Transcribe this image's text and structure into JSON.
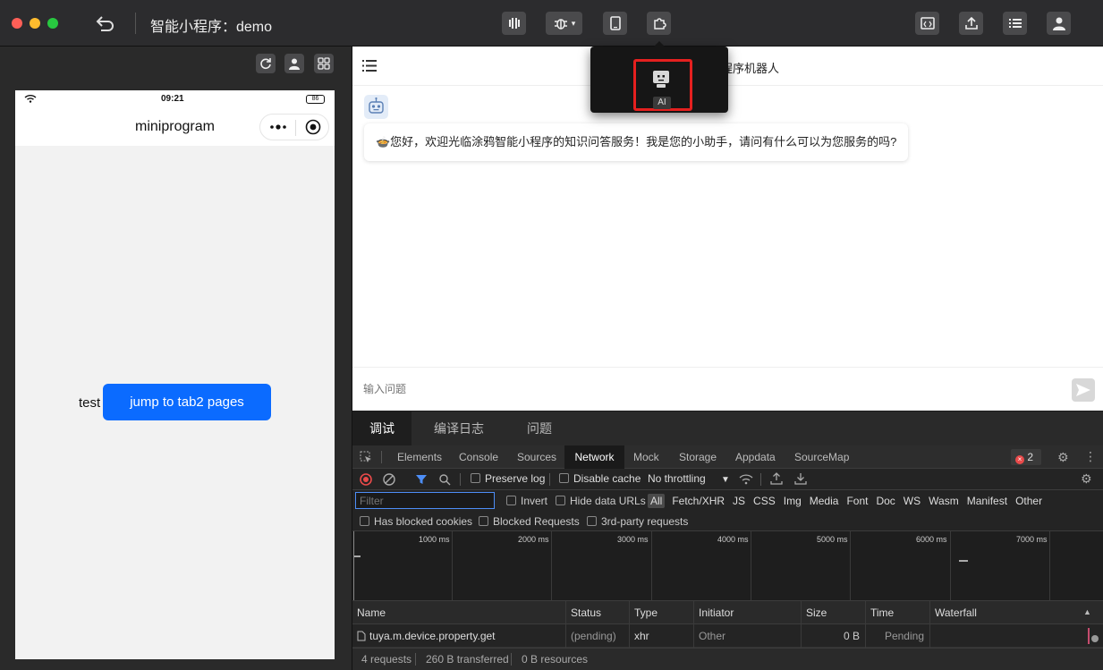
{
  "window": {
    "title": "智能小程序：demo"
  },
  "toolbar": {
    "colors": {
      "close": "#fe5f57",
      "minimize": "#febc2e",
      "maximize": "#28c840"
    }
  },
  "popover": {
    "ai_label": "AI",
    "highlight_color": "#e5201f"
  },
  "simulator": {
    "status_time": "09:21",
    "battery": "86",
    "nav_title": "miniprogram",
    "test_label": "test",
    "jump_button": "jump to tab2 pages",
    "accent": "#0b6bff"
  },
  "chat": {
    "title": "程序机器人",
    "greeting": "🍲您好，欢迎光临涂鸦智能小程序的知识问答服务！我是您的小助手，请问有什么可以为您服务的吗?",
    "input_placeholder": "输入问题"
  },
  "devtools": {
    "bottom_tabs": [
      "调试",
      "编译日志",
      "问题"
    ],
    "panel_tabs": [
      "Elements",
      "Console",
      "Sources",
      "Network",
      "Mock",
      "Storage",
      "Appdata",
      "SourceMap"
    ],
    "active_panel": "Network",
    "error_count": "2",
    "network_toolbar": {
      "preserve_log": "Preserve log",
      "disable_cache": "Disable cache",
      "throttling": "No throttling"
    },
    "filter": {
      "placeholder": "Filter",
      "invert": "Invert",
      "hide_data_urls": "Hide data URLs",
      "types": [
        "All",
        "Fetch/XHR",
        "JS",
        "CSS",
        "Img",
        "Media",
        "Font",
        "Doc",
        "WS",
        "Wasm",
        "Manifest",
        "Other"
      ],
      "has_blocked_cookies": "Has blocked cookies",
      "blocked_requests": "Blocked Requests",
      "third_party": "3rd-party requests"
    },
    "timeline_ticks": [
      "1000 ms",
      "2000 ms",
      "3000 ms",
      "4000 ms",
      "5000 ms",
      "6000 ms",
      "7000 ms"
    ],
    "columns": [
      "Name",
      "Status",
      "Type",
      "Initiator",
      "Size",
      "Time",
      "Waterfall"
    ],
    "rows": [
      {
        "name": "tuya.m.device.property.get",
        "status": "(pending)",
        "type": "xhr",
        "initiator": "Other",
        "size": "0 B",
        "time": "Pending"
      }
    ],
    "summary": {
      "requests": "4 requests",
      "transferred": "260 B transferred",
      "resources": "0 B resources"
    }
  }
}
